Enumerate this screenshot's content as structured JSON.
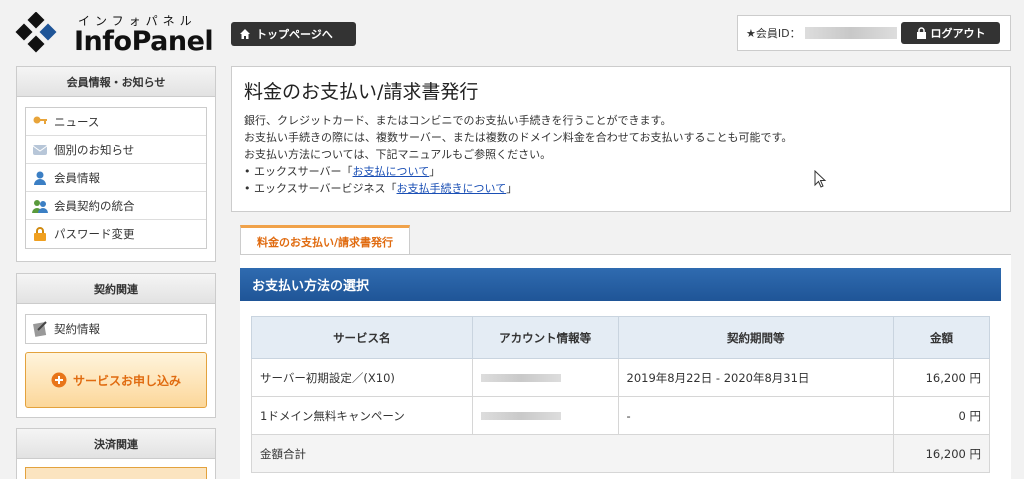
{
  "logo": {
    "kana": "インフォパネル",
    "name": "InfoPanel"
  },
  "header": {
    "top_button": "トップページへ",
    "member_label": "★会員ID：",
    "logout_button": "ログアウト"
  },
  "sidebar": {
    "panels": [
      {
        "title": "会員情報・お知らせ",
        "items": [
          {
            "label": "ニュース",
            "icon": "key-icon"
          },
          {
            "label": "個別のお知らせ",
            "icon": "message-icon"
          },
          {
            "label": "会員情報",
            "icon": "person-icon"
          },
          {
            "label": "会員契約の統合",
            "icon": "merge-users-icon"
          },
          {
            "label": "パスワード変更",
            "icon": "lock-icon"
          }
        ]
      },
      {
        "title": "契約関連",
        "items": [
          {
            "label": "契約情報",
            "icon": "document-icon"
          }
        ],
        "service_button": "サービスお申し込み"
      },
      {
        "title": "決済関連"
      }
    ]
  },
  "main": {
    "title": "料金のお支払い/請求書発行",
    "paragraphs": [
      "銀行、クレジットカード、またはコンビニでのお支払い手続きを行うことができます。",
      "お支払い手続きの際には、複数サーバー、または複数のドメイン料金を合わせてお支払いすることも可能です。",
      "お支払い方法については、下記マニュアルもご参照ください。"
    ],
    "links": [
      {
        "prefix": "• エックスサーバー「",
        "text": "お支払について",
        "suffix": "」"
      },
      {
        "prefix": "• エックスサーバービジネス「",
        "text": "お支払手続きについて",
        "suffix": "」"
      }
    ],
    "tab_label": "料金のお支払い/請求書発行",
    "section_title": "お支払い方法の選択",
    "table": {
      "headers": [
        "サービス名",
        "アカウント情報等",
        "契約期間等",
        "金額"
      ],
      "rows": [
        {
          "service": "サーバー初期設定／(X10)",
          "period": "2019年8月22日 - 2020年8月31日",
          "amount": "16,200 円"
        },
        {
          "service": "1ドメイン無料キャンペーン",
          "period": "-",
          "amount": "0 円"
        }
      ],
      "total_label": "金額合計",
      "total_amount": "16,200 円"
    }
  },
  "colors": {
    "accent_orange": "#e06b10",
    "section_blue": "#1f5597",
    "link_blue": "#1a4fb5"
  }
}
